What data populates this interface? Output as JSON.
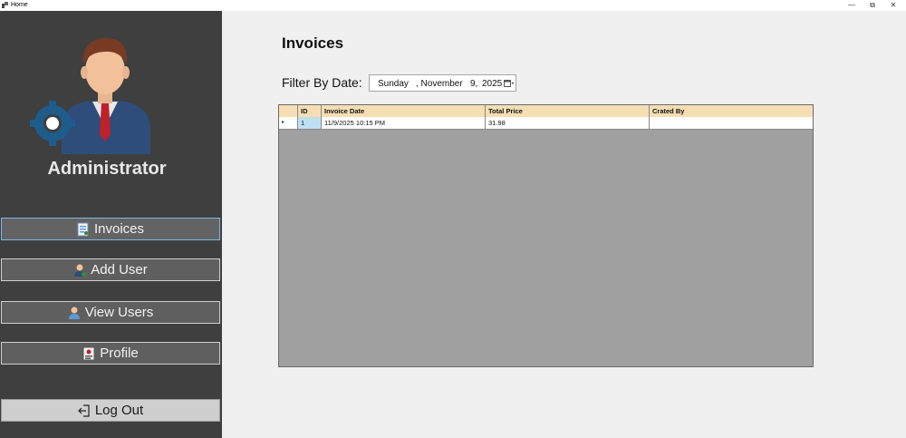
{
  "window": {
    "title": "Home",
    "controls": {
      "minimize": "—",
      "restore": "⧉",
      "close": "✕"
    }
  },
  "sidebar": {
    "role": "Administrator",
    "items": [
      {
        "label": "Invoices",
        "icon": "invoice-icon"
      },
      {
        "label": "Add User",
        "icon": "add-user-icon"
      },
      {
        "label": "View Users",
        "icon": "users-icon"
      },
      {
        "label": "Profile",
        "icon": "profile-icon"
      }
    ],
    "logout": {
      "label": "Log Out",
      "icon": "logout-icon"
    }
  },
  "main": {
    "title": "Invoices",
    "filter": {
      "label": "Filter By Date:",
      "day": "Sunday",
      "month": ", November",
      "date": "9,",
      "year": "2025"
    },
    "grid": {
      "columns": [
        "ID",
        "Invoice Date",
        "Total Price",
        "Crated By"
      ],
      "rows": [
        {
          "indicator": "▸",
          "id": "1",
          "invoice_date": "11/9/2025 10:15 PM",
          "total_price": "31.98",
          "created_by": ""
        }
      ]
    }
  },
  "colors": {
    "sidebar": "#3f3f3f",
    "header": "#f5deb3",
    "grid_bg": "#a0a0a0",
    "selected_cell": "#bfe0f2"
  }
}
